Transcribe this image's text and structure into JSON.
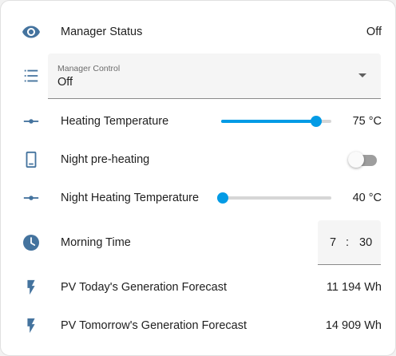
{
  "colors": {
    "icon": "#44739e",
    "accent": "#039be5",
    "divider": "#8a8a8a"
  },
  "rows": {
    "manager_status": {
      "icon": "eye-icon",
      "label": "Manager Status",
      "value": "Off"
    },
    "manager_control": {
      "icon": "list-icon",
      "caption": "Manager Control",
      "value": "Off"
    },
    "heating_temperature": {
      "icon": "slider-icon",
      "label": "Heating Temperature",
      "value": "75 °C",
      "slider_fraction": 0.86
    },
    "night_preheating": {
      "icon": "phone-icon",
      "label": "Night pre-heating",
      "toggle_on": false
    },
    "night_heating_temperature": {
      "icon": "slider-icon",
      "label": "Night Heating Temperature",
      "value": "40 °C",
      "slider_fraction": 0.0
    },
    "morning_time": {
      "icon": "clock-icon",
      "label": "Morning Time",
      "hour": "7",
      "separator": ":",
      "minute": "30"
    },
    "pv_today": {
      "icon": "flash-icon",
      "label": "PV Today's Generation Forecast",
      "value": "11 194 Wh"
    },
    "pv_tomorrow": {
      "icon": "flash-icon",
      "label": "PV Tomorrow's Generation Forecast",
      "value": "14 909 Wh"
    }
  }
}
